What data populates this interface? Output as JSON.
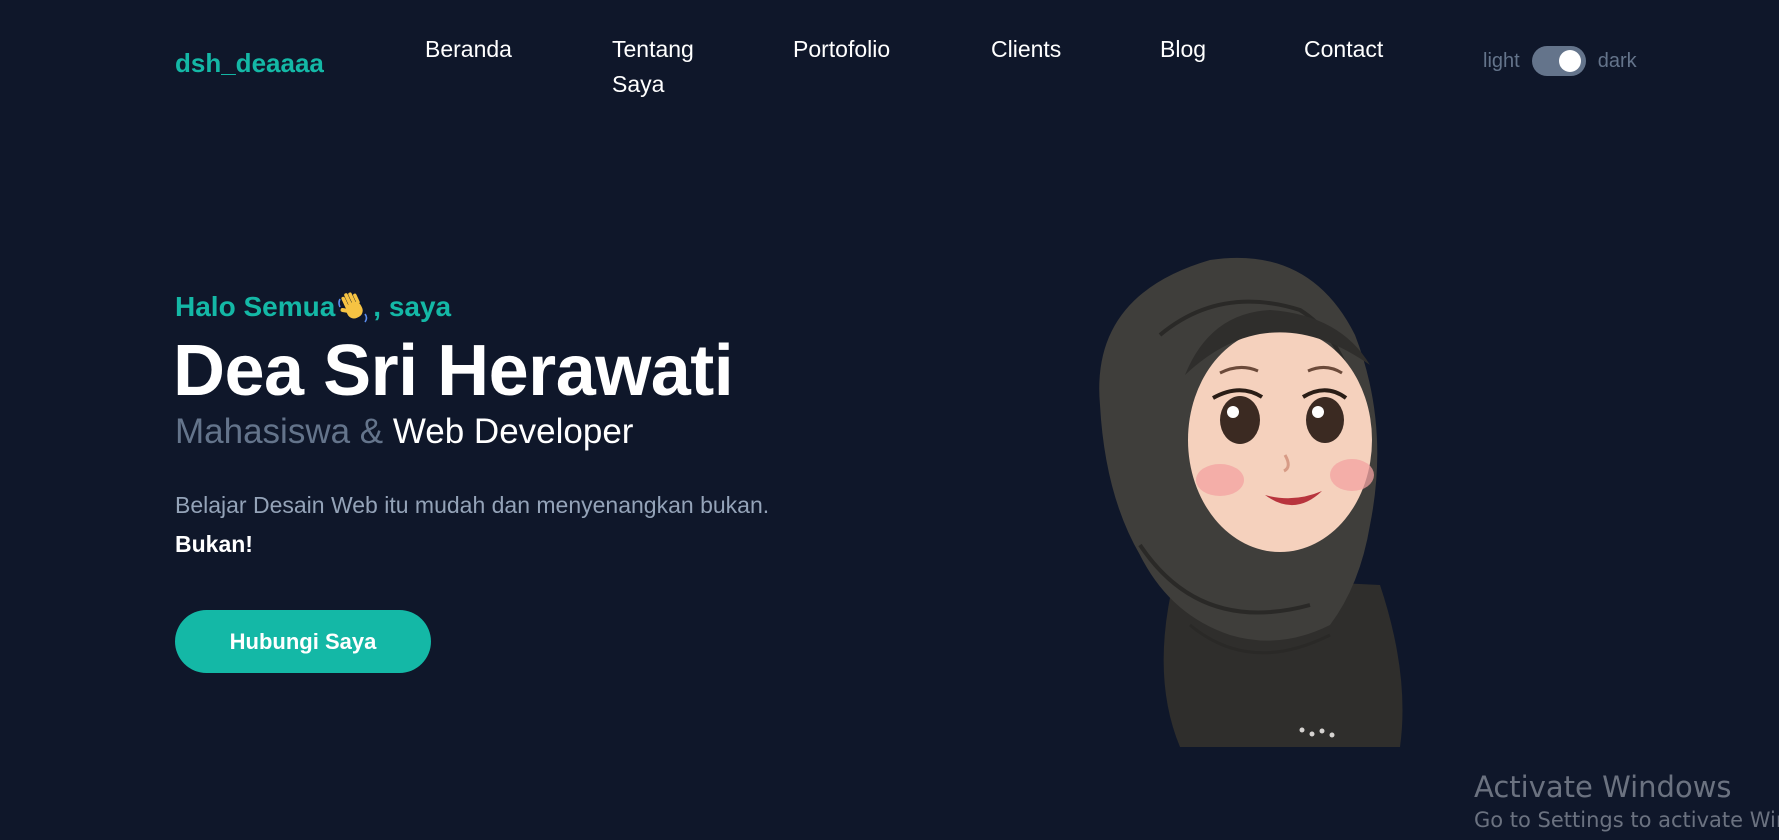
{
  "nav": {
    "logo": "dsh_deaaaa",
    "items": [
      {
        "label": "Beranda"
      },
      {
        "label": "Tentang Saya"
      },
      {
        "label": "Portofolio"
      },
      {
        "label": "Clients"
      },
      {
        "label": "Blog"
      },
      {
        "label": "Contact"
      }
    ],
    "theme": {
      "light_label": "light",
      "dark_label": "dark",
      "state": "dark"
    }
  },
  "hero": {
    "greeting_prefix": "Halo Semua",
    "greeting_icon": "waving-hand-icon",
    "greeting_suffix": ", saya",
    "name": "Dea Sri Herawati",
    "role_primary": "Mahasiswa &",
    "role_accent": "Web Developer",
    "description": "Belajar Desain Web itu mudah dan menyenangkan bukan.",
    "description_strong": "Bukan!",
    "cta_label": "Hubungi Saya"
  },
  "watermark": {
    "title": "Activate Windows",
    "subtitle": "Go to Settings to activate Windows."
  },
  "colors": {
    "background": "#0f172a",
    "accent": "#14b8a6",
    "muted": "#64748b",
    "text": "#ffffff"
  }
}
